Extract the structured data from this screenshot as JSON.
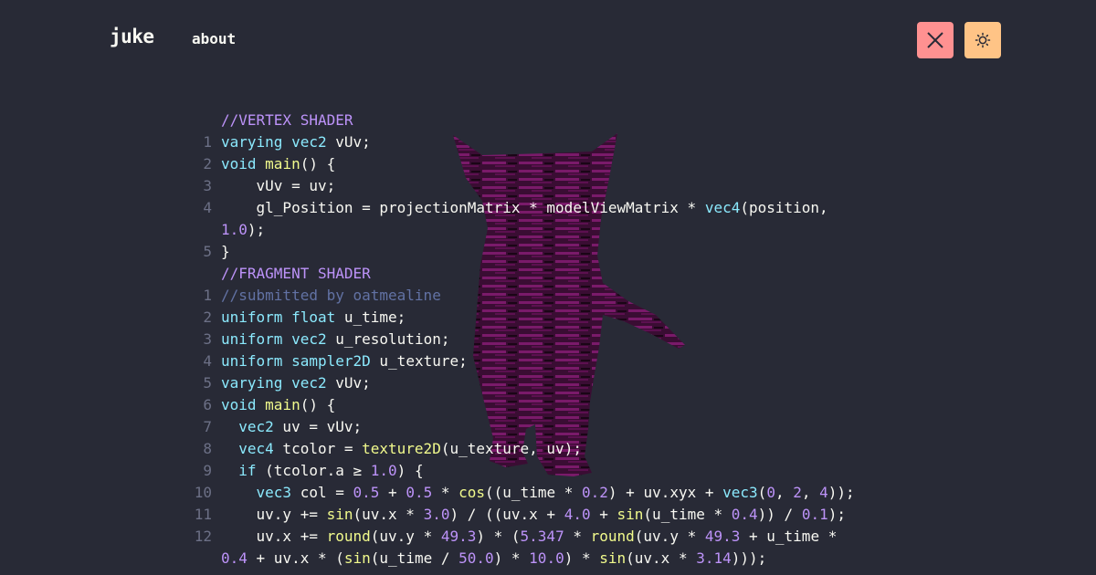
{
  "nav": {
    "logo": "juke",
    "about": "about",
    "close_icon": "close-icon",
    "theme_icon": "sun-icon"
  },
  "colors": {
    "background": "#282a36",
    "close_button": "#ff9191",
    "theme_button": "#ffc486",
    "keyword": "#8be9fd",
    "function": "#f1fa8c",
    "number": "#bd93f9",
    "comment": "#6272a4"
  },
  "code": {
    "vertex_header": "//VERTEX SHADER",
    "fragment_header": "//FRAGMENT SHADER",
    "lines": [
      {
        "n": "",
        "t": "//VERTEX SHADER"
      },
      {
        "n": "1",
        "t": "varying vec2 vUv;"
      },
      {
        "n": "2",
        "t": "void main() {"
      },
      {
        "n": "3",
        "t": "    vUv = uv;"
      },
      {
        "n": "4",
        "t": "    gl_Position = projectionMatrix * modelViewMatrix * vec4(position,"
      },
      {
        "n": "",
        "t": "1.0);"
      },
      {
        "n": "5",
        "t": "}"
      },
      {
        "n": "",
        "t": "//FRAGMENT SHADER"
      },
      {
        "n": "1",
        "t": "//submitted by oatmealine"
      },
      {
        "n": "2",
        "t": "uniform float u_time;"
      },
      {
        "n": "3",
        "t": "uniform vec2 u_resolution;"
      },
      {
        "n": "4",
        "t": "uniform sampler2D u_texture;"
      },
      {
        "n": "5",
        "t": "varying vec2 vUv;"
      },
      {
        "n": "6",
        "t": "void main() {"
      },
      {
        "n": "7",
        "t": "  vec2 uv = vUv;"
      },
      {
        "n": "8",
        "t": "  vec4 tcolor = texture2D(u_texture, uv);"
      },
      {
        "n": "9",
        "t": "  if (tcolor.a ≥ 1.0) {"
      },
      {
        "n": "10",
        "t": "    vec3 col = 0.5 + 0.5 * cos((u_time * 0.2) + uv.xyx + vec3(0, 2, 4));"
      },
      {
        "n": "11",
        "t": "    uv.y += sin(uv.x * 3.0) / ((uv.x + 4.0 + sin(u_time * 0.4)) / 0.1);"
      },
      {
        "n": "12",
        "t": "    uv.x += round(uv.y * 49.3) * (5.347 * round(uv.y * 49.3 + u_time *"
      },
      {
        "n": "",
        "t": "0.4 + uv.x * (sin(u_time / 50.0) * 10.0) * sin(uv.x * 3.14)));"
      }
    ]
  }
}
